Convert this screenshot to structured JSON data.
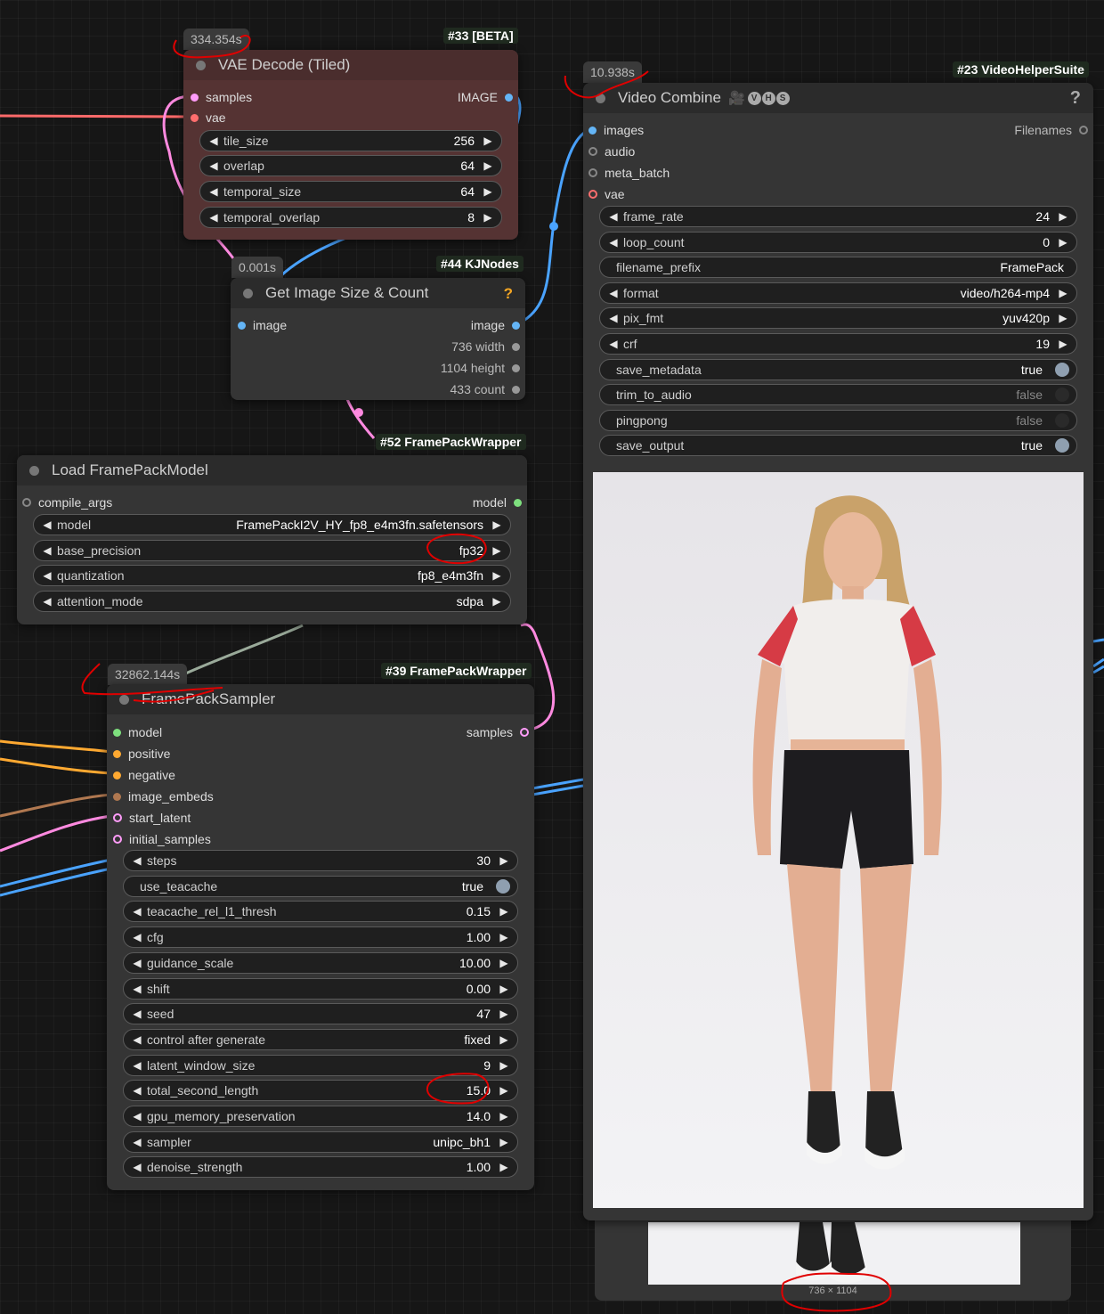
{
  "colors": {
    "latent": "#ff9cf9",
    "vae": "#ff6e6e",
    "image": "#64b5f6",
    "model": "#b39ddb",
    "conditioning": "#ffa931",
    "image_embeds": "#b07850",
    "wire_red": "#ff5a5a",
    "wire_blue": "#4aa3ff",
    "wire_pink": "#ff8ae0",
    "wire_orange": "#ffa931",
    "wire_gray": "#9aaa9a",
    "annotation_red": "#e00000"
  },
  "vae_decode": {
    "timer": "334.354s",
    "badge": "#33 [BETA]",
    "title": "VAE Decode (Tiled)",
    "inputs": [
      "samples",
      "vae"
    ],
    "output": "IMAGE",
    "widgets": [
      {
        "label": "tile_size",
        "value": "256"
      },
      {
        "label": "overlap",
        "value": "64"
      },
      {
        "label": "temporal_size",
        "value": "64"
      },
      {
        "label": "temporal_overlap",
        "value": "8"
      }
    ]
  },
  "get_image_size": {
    "timer": "0.001s",
    "badge": "#44 KJNodes",
    "title": "Get Image Size & Count",
    "help": "?",
    "input": "image",
    "outputs": [
      "image",
      "736 width",
      "1104 height",
      "433 count"
    ]
  },
  "load_model": {
    "badge": "#52 FramePackWrapper",
    "title": "Load FramePackModel",
    "input": "compile_args",
    "output": "model",
    "widgets": [
      {
        "label": "model",
        "value": "FramePackI2V_HY_fp8_e4m3fn.safetensors"
      },
      {
        "label": "base_precision",
        "value": "fp32"
      },
      {
        "label": "quantization",
        "value": "fp8_e4m3fn"
      },
      {
        "label": "attention_mode",
        "value": "sdpa"
      }
    ]
  },
  "sampler": {
    "timer": "32862.144s",
    "badge": "#39 FramePackWrapper",
    "title": "FramePackSampler",
    "inputs": [
      "model",
      "positive",
      "negative",
      "image_embeds",
      "start_latent",
      "initial_samples"
    ],
    "output": "samples",
    "widgets": [
      {
        "label": "steps",
        "value": "30",
        "kind": "arrows"
      },
      {
        "label": "use_teacache",
        "value": "true",
        "kind": "toggle"
      },
      {
        "label": "teacache_rel_l1_thresh",
        "value": "0.15",
        "kind": "arrows"
      },
      {
        "label": "cfg",
        "value": "1.00",
        "kind": "arrows"
      },
      {
        "label": "guidance_scale",
        "value": "10.00",
        "kind": "arrows"
      },
      {
        "label": "shift",
        "value": "0.00",
        "kind": "arrows"
      },
      {
        "label": "seed",
        "value": "47",
        "kind": "arrows"
      },
      {
        "label": "control after generate",
        "value": "fixed",
        "kind": "arrows"
      },
      {
        "label": "latent_window_size",
        "value": "9",
        "kind": "arrows"
      },
      {
        "label": "total_second_length",
        "value": "15.0",
        "kind": "arrows"
      },
      {
        "label": "gpu_memory_preservation",
        "value": "14.0",
        "kind": "arrows"
      },
      {
        "label": "sampler",
        "value": "unipc_bh1",
        "kind": "arrows"
      },
      {
        "label": "denoise_strength",
        "value": "1.00",
        "kind": "arrows"
      }
    ]
  },
  "video_combine": {
    "timer": "10.938s",
    "badge": "#23 VideoHelperSuite",
    "title": "Video Combine",
    "vhs_letters": [
      "V",
      "H",
      "S"
    ],
    "help": "?",
    "inputs": [
      "images",
      "audio",
      "meta_batch",
      "vae"
    ],
    "output": "Filenames",
    "widgets": [
      {
        "label": "frame_rate",
        "value": "24",
        "kind": "arrows"
      },
      {
        "label": "loop_count",
        "value": "0",
        "kind": "arrows"
      },
      {
        "label": "filename_prefix",
        "value": "FramePack",
        "kind": "text"
      },
      {
        "label": "format",
        "value": "video/h264-mp4",
        "kind": "arrows"
      },
      {
        "label": "pix_fmt",
        "value": "yuv420p",
        "kind": "arrows"
      },
      {
        "label": "crf",
        "value": "19",
        "kind": "arrows"
      },
      {
        "label": "save_metadata",
        "value": "true",
        "kind": "toggle"
      },
      {
        "label": "trim_to_audio",
        "value": "false",
        "kind": "toggle"
      },
      {
        "label": "pingpong",
        "value": "false",
        "kind": "toggle"
      },
      {
        "label": "save_output",
        "value": "true",
        "kind": "toggle"
      }
    ]
  },
  "preview": {
    "dimensions": "736 × 1104"
  }
}
